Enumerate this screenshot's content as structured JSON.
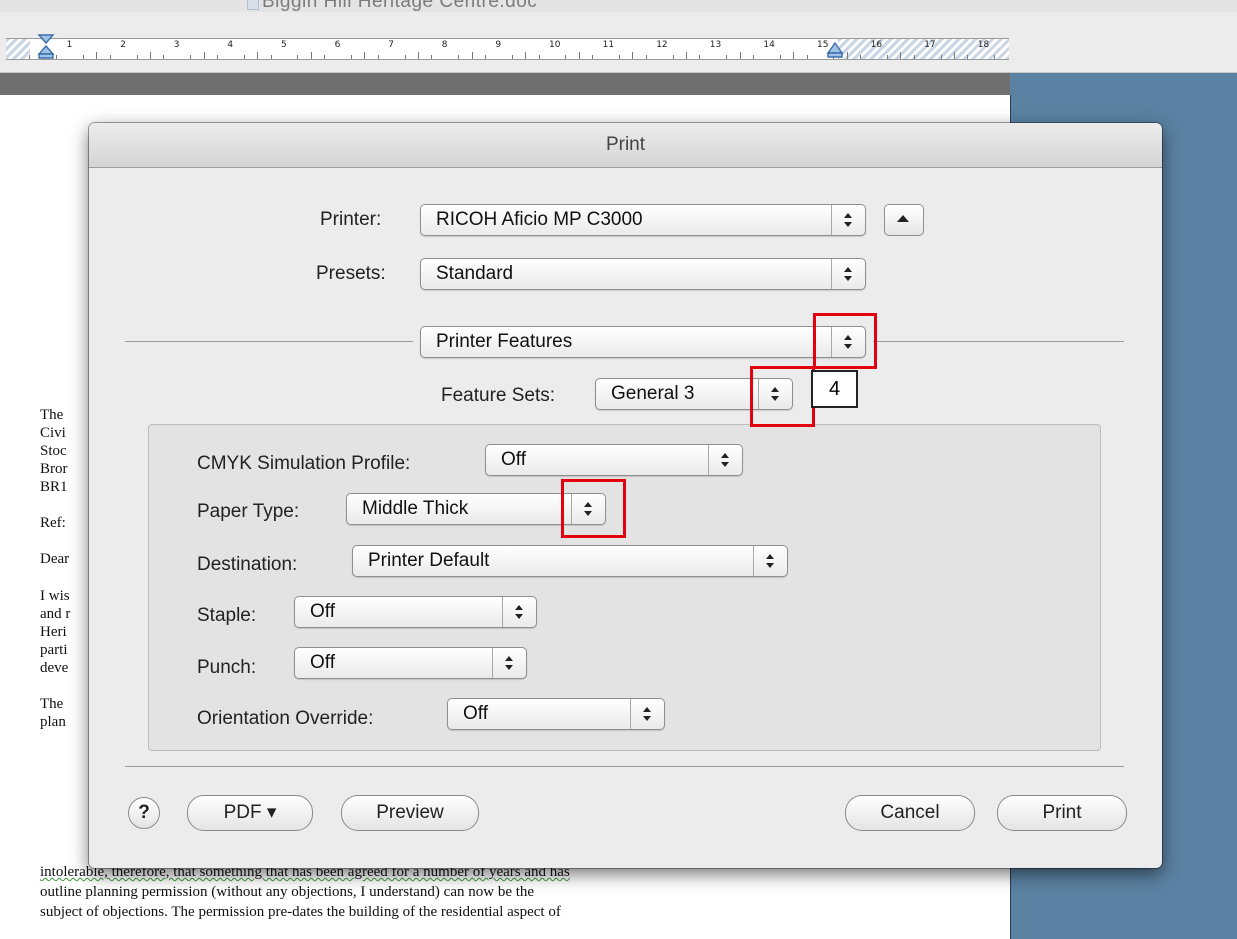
{
  "window": {
    "document_title": "Biggin Hill Heritage Centre.doc"
  },
  "ruler": {
    "numbers": [
      "1",
      "2",
      "3",
      "4",
      "5",
      "6",
      "7",
      "8",
      "9",
      "10",
      "11",
      "12",
      "13",
      "14",
      "15",
      "16",
      "17",
      "18"
    ]
  },
  "document": {
    "left_fragments": [
      "The",
      "Civi",
      "Stoc",
      "Bror",
      "BR1",
      "Ref:",
      "Dear",
      "I wis",
      "and r",
      "Heri",
      "parti",
      "deve",
      "The",
      "plan"
    ],
    "body_lines": [
      "intolerable, therefore, that something that has been agreed for a number of years and has",
      "outline planning permission (without any objections, I understand) can now be the",
      "subject of objections. The permission pre-dates the building of the residential aspect of"
    ]
  },
  "dialog": {
    "title": "Print",
    "printer_label": "Printer:",
    "printer_value": "RICOH Aficio MP C3000",
    "presets_label": "Presets:",
    "presets_value": "Standard",
    "section_value": "Printer Features",
    "feature_sets_label": "Feature Sets:",
    "feature_sets_value": "General 3",
    "options": [
      {
        "label": "CMYK Simulation Profile:",
        "value": "Off"
      },
      {
        "label": "Paper Type:",
        "value": "Middle Thick"
      },
      {
        "label": "Destination:",
        "value": "Printer Default"
      },
      {
        "label": "Staple:",
        "value": "Off"
      },
      {
        "label": "Punch:",
        "value": "Off"
      },
      {
        "label": "Orientation Override:",
        "value": "Off"
      }
    ],
    "buttons": {
      "help": "?",
      "pdf": "PDF ▾",
      "preview": "Preview",
      "cancel": "Cancel",
      "print": "Print"
    }
  },
  "annotation": {
    "step_number": "4",
    "highlight_color": "#e3000f"
  }
}
